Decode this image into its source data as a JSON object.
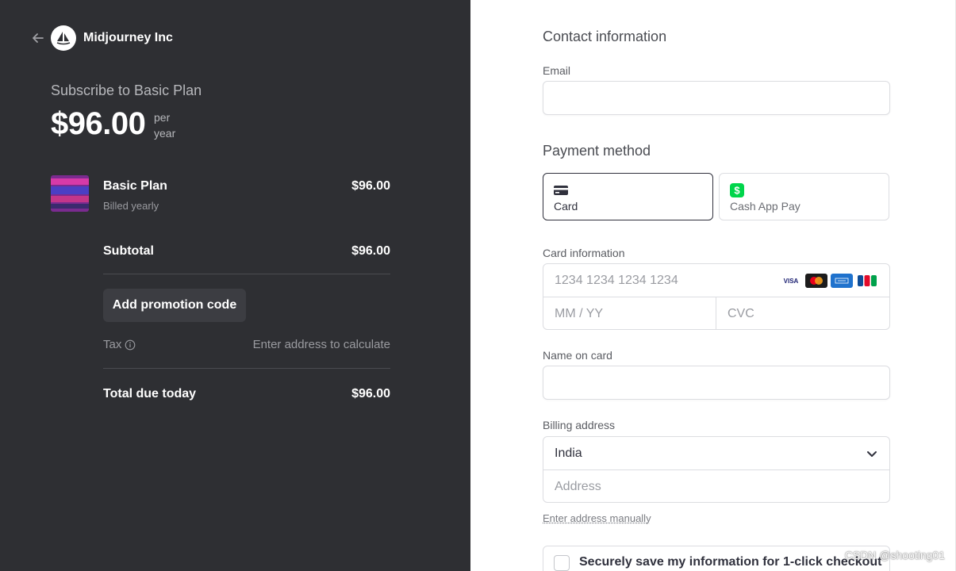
{
  "merchant": {
    "name": "Midjourney Inc"
  },
  "summary": {
    "subscribe_title": "Subscribe to Basic Plan",
    "price": "$96.00",
    "period_line1": "per",
    "period_line2": "year"
  },
  "line_item": {
    "name": "Basic Plan",
    "billing": "Billed yearly",
    "price": "$96.00"
  },
  "totals": {
    "subtotal_label": "Subtotal",
    "subtotal_value": "$96.00",
    "promo_label": "Add promotion code",
    "tax_label": "Tax",
    "tax_value": "Enter address to calculate",
    "total_label": "Total due today",
    "total_value": "$96.00"
  },
  "form": {
    "contact_heading": "Contact information",
    "email_label": "Email",
    "email_value": "",
    "payment_heading": "Payment method",
    "methods": [
      {
        "label": "Card",
        "icon": "card-icon",
        "selected": true
      },
      {
        "label": "Cash App Pay",
        "icon": "cash-app-icon",
        "selected": false
      }
    ],
    "card_info_label": "Card information",
    "card_number_placeholder": "1234 1234 1234 1234",
    "card_brands": [
      "VISA",
      "Mastercard",
      "Amex",
      "JCB"
    ],
    "expiry_placeholder": "MM / YY",
    "cvc_placeholder": "CVC",
    "name_label": "Name on card",
    "name_value": "",
    "billing_label": "Billing address",
    "country_value": "India",
    "address_placeholder": "Address",
    "manual_address_link": "Enter address manually",
    "save_info_label": "Securely save my information for 1-click checkout"
  },
  "watermark": "CSDN @shooting01",
  "colors": {
    "left_panel_bg": "#2e2f33",
    "cash_app_green": "#00d54b",
    "text_dark": "#30313d"
  }
}
